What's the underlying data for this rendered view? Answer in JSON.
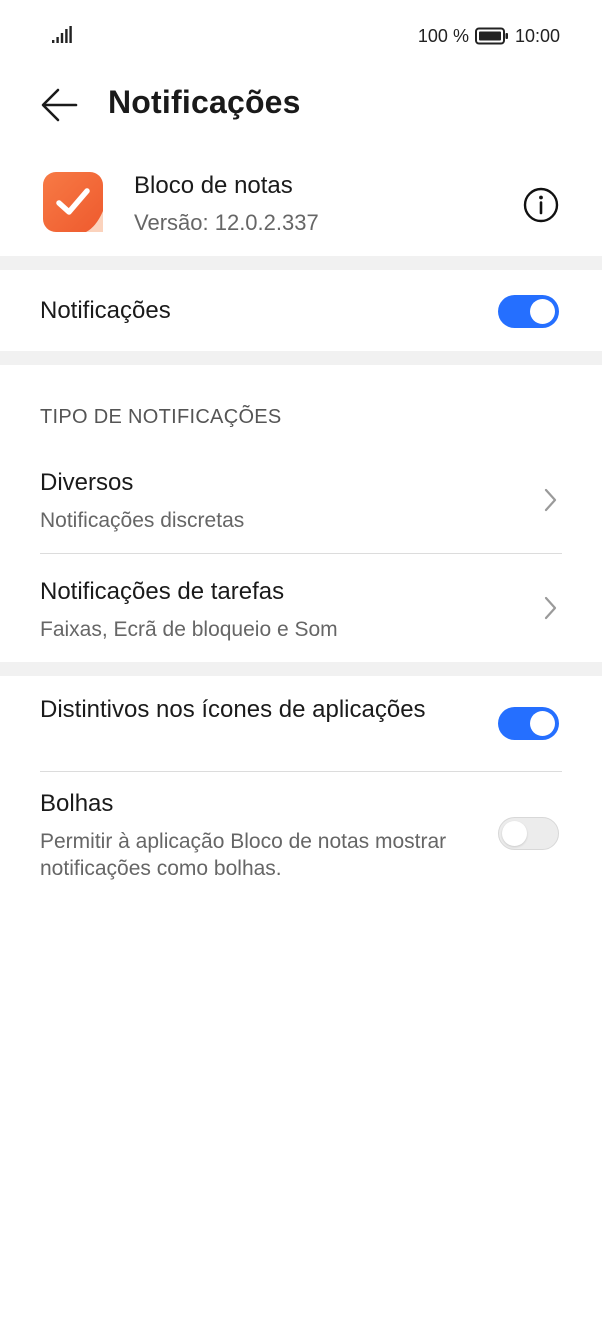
{
  "status_bar": {
    "battery_text": "100 %",
    "time": "10:00",
    "icons": [
      "signal-icon",
      "battery-icon"
    ]
  },
  "header": {
    "title": "Notificações",
    "back_icon": "arrow-left-icon"
  },
  "app": {
    "name": "Bloco de notas",
    "version": "Versão: 12.0.2.337",
    "icon": "notepad-check-icon",
    "info_icon": "info-icon",
    "icon_color": "#f0643a"
  },
  "notifications_toggle": {
    "label": "Notificações",
    "on": true
  },
  "notification_types": {
    "header": "TIPO DE NOTIFICAÇÕES",
    "items": [
      {
        "title": "Diversos",
        "subtitle": "Notificações discretas"
      },
      {
        "title": "Notificações de tarefas",
        "subtitle": "Faixas, Ecrã de bloqueio e Som"
      }
    ]
  },
  "badges": {
    "label": "Distintivos nos ícones de aplicações",
    "on": true
  },
  "bubbles": {
    "title": "Bolhas",
    "subtitle": "Permitir à aplicação Bloco de notas mostrar notificações como bolhas.",
    "on": false
  },
  "colors": {
    "accent": "#256fff",
    "separator": "#f1f1f1"
  }
}
